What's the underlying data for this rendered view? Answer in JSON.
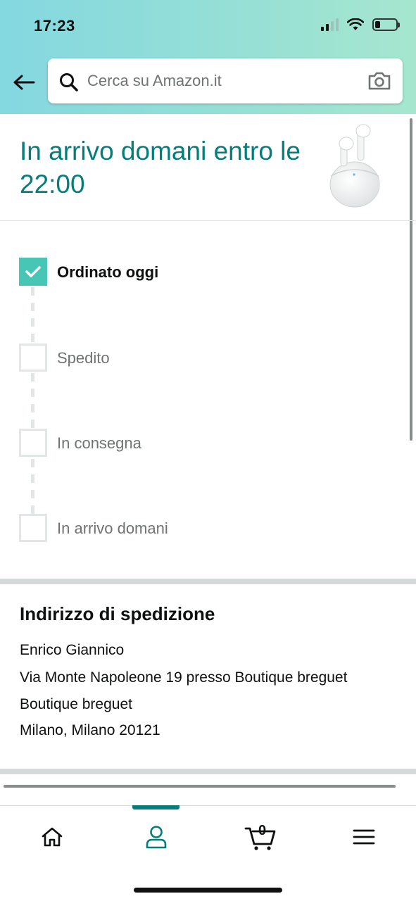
{
  "status_bar": {
    "time": "17:23"
  },
  "search": {
    "placeholder": "Cerca su Amazon.it"
  },
  "arrival": {
    "title": "In arrivo domani entro le 22:00"
  },
  "timeline": {
    "steps": [
      {
        "label": "Ordinato oggi",
        "checked": true
      },
      {
        "label": "Spedito",
        "checked": false
      },
      {
        "label": "In consegna",
        "checked": false
      },
      {
        "label": "In arrivo domani",
        "checked": false
      }
    ]
  },
  "address": {
    "title": "Indirizzo di spedizione",
    "lines": [
      "Enrico Giannico",
      "Via Monte Napoleone 19 presso Boutique breguet",
      "Boutique breguet",
      "Milano, Milano 20121"
    ]
  },
  "tabbar": {
    "cart_count": "0",
    "active_tab": "account"
  },
  "colors": {
    "accent": "#067d7a",
    "check": "#48c6b5",
    "header_start": "#84d8e0",
    "header_end": "#a6e6cf"
  }
}
